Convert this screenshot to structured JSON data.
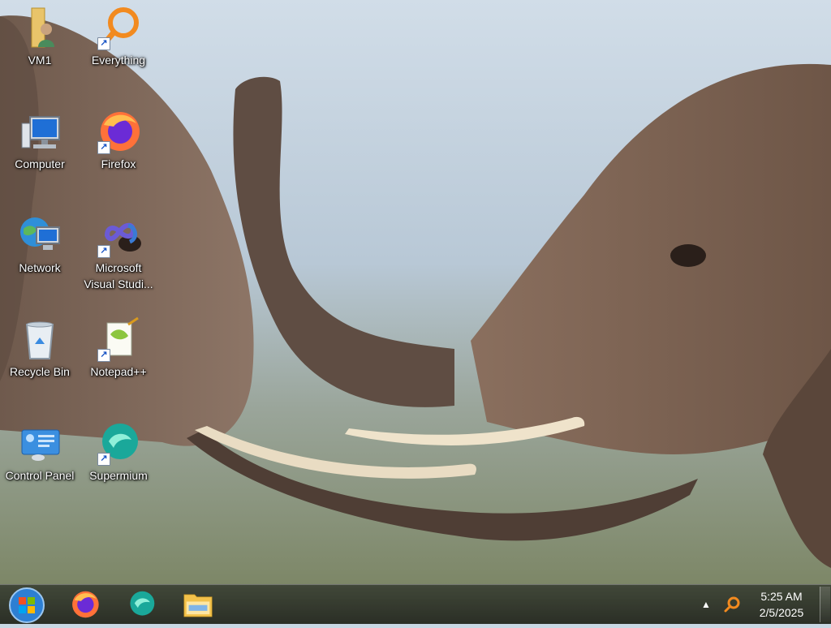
{
  "desktop": {
    "icons": [
      {
        "label": "VM1",
        "icon": "user-folder-icon",
        "shortcut": false
      },
      {
        "label": "Everything",
        "icon": "everything-search-icon",
        "shortcut": true
      },
      {
        "label": "Computer",
        "icon": "computer-icon",
        "shortcut": false
      },
      {
        "label": "Firefox",
        "icon": "firefox-icon",
        "shortcut": true
      },
      {
        "label": "Network",
        "icon": "network-icon",
        "shortcut": false
      },
      {
        "label": "Microsoft\nVisual Studi...",
        "label_line1": "Microsoft",
        "label_line2": "Visual Studi...",
        "icon": "visual-studio-icon",
        "shortcut": true
      },
      {
        "label": "Recycle Bin",
        "icon": "recycle-bin-icon",
        "shortcut": false
      },
      {
        "label": "Notepad++",
        "icon": "notepad-plus-plus-icon",
        "shortcut": true
      },
      {
        "label": "Control Panel",
        "icon": "control-panel-icon",
        "shortcut": false
      },
      {
        "label": "Supermium",
        "icon": "supermium-icon",
        "shortcut": true
      }
    ]
  },
  "taskbar": {
    "pinned": [
      {
        "icon": "firefox-icon"
      },
      {
        "icon": "supermium-icon"
      },
      {
        "icon": "file-explorer-icon"
      }
    ],
    "tray": {
      "overflow_icon": "chevron-up-icon",
      "search_icon": "everything-search-icon"
    },
    "clock": {
      "time": "5:25 AM",
      "date": "2/5/2025"
    }
  },
  "colors": {
    "taskbar": "#2f3529",
    "label_text": "#ffffff",
    "sky": "#c9d8e4"
  }
}
